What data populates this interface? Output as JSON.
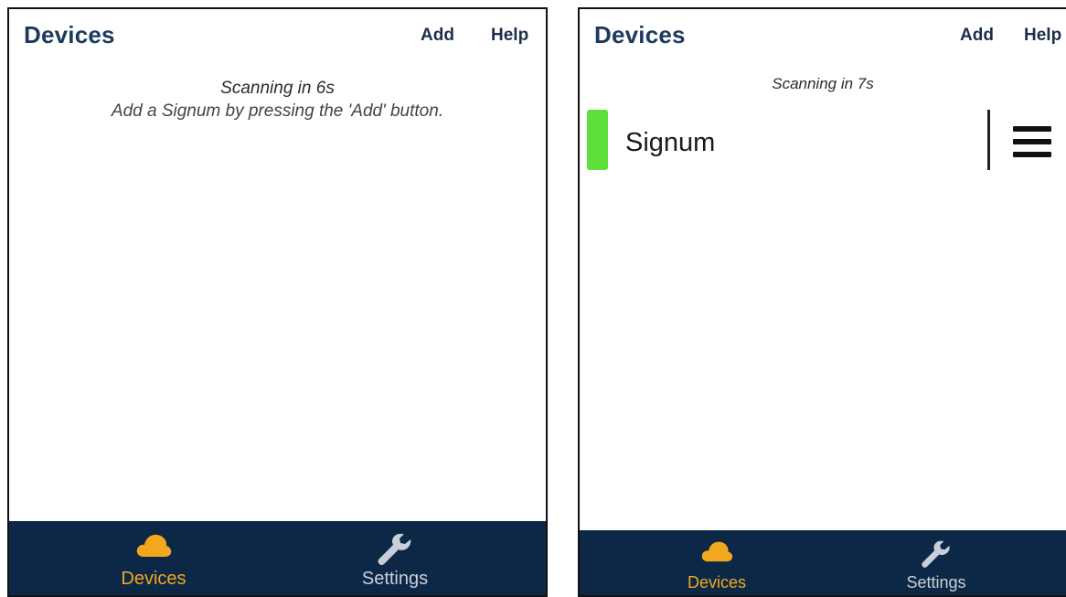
{
  "screens": [
    {
      "header": {
        "title": "Devices",
        "add_label": "Add",
        "help_label": "Help"
      },
      "status": "Scanning in 6s",
      "hint": "Add a Signum by pressing the 'Add' button.",
      "devices": [],
      "nav": {
        "active": "devices",
        "items": [
          {
            "id": "devices",
            "label": "Devices",
            "icon": "cloud-icon"
          },
          {
            "id": "settings",
            "label": "Settings",
            "icon": "wrench-icon"
          }
        ]
      }
    },
    {
      "header": {
        "title": "Devices",
        "add_label": "Add",
        "help_label": "Help"
      },
      "status": "Scanning in 7s",
      "devices": [
        {
          "name": "Signum",
          "status_color": "#5ee03c"
        }
      ],
      "nav": {
        "active": "devices",
        "items": [
          {
            "id": "devices",
            "label": "Devices",
            "icon": "cloud-icon"
          },
          {
            "id": "settings",
            "label": "Settings",
            "icon": "wrench-icon"
          }
        ]
      }
    }
  ],
  "colors": {
    "title": "#1c3a5e",
    "nav_background": "#0d2847",
    "nav_active": "#f2a81d",
    "nav_inactive": "#c9cfd8"
  }
}
